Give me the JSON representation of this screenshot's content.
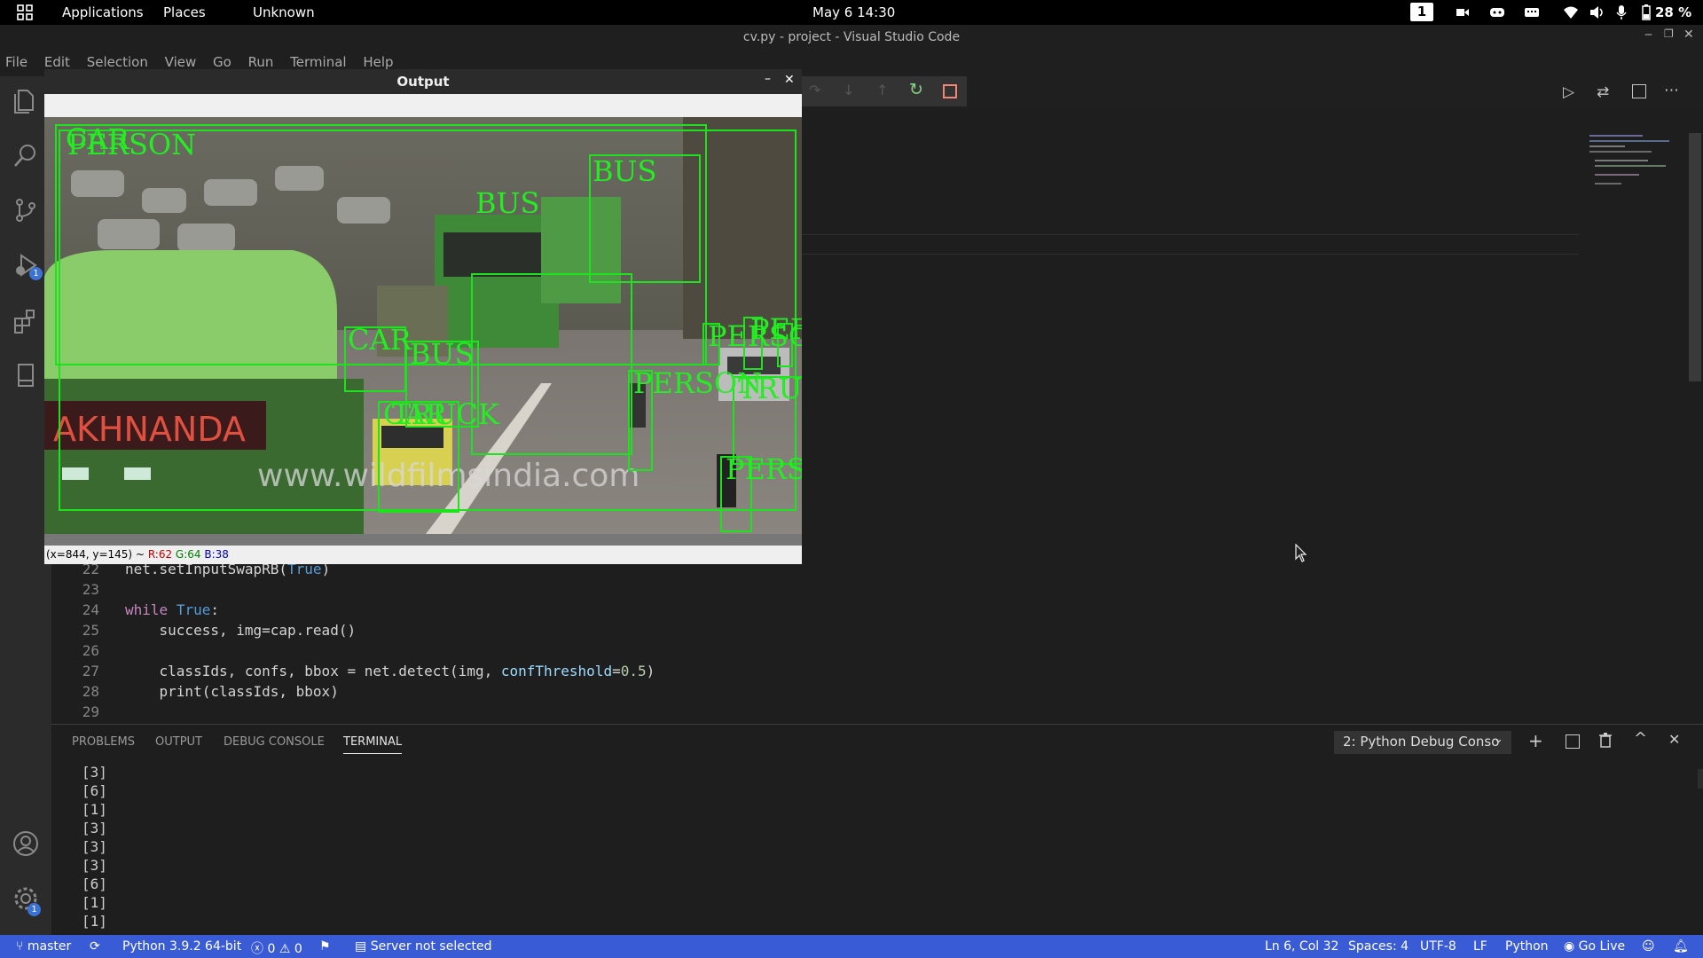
{
  "topbar": {
    "applications": "Applications",
    "places": "Places",
    "unknown": "Unknown",
    "datetime": "May 6  14:30",
    "workspace": "1",
    "battery": "28 %"
  },
  "window": {
    "title": "cv.py - project - Visual Studio Code"
  },
  "menu": [
    "File",
    "Edit",
    "Selection",
    "View",
    "Go",
    "Run",
    "Terminal",
    "Help"
  ],
  "activity": {
    "debug_badge": "1",
    "settings_badge": "1"
  },
  "code": {
    "lines": [
      {
        "n": "22",
        "parts": [
          [
            "",
            "net.setInputSwapRB("
          ],
          [
            "bl",
            "True"
          ],
          [
            "",
            ")"
          ]
        ]
      },
      {
        "n": "23",
        "parts": []
      },
      {
        "n": "24",
        "parts": [
          [
            "kw",
            "while"
          ],
          [
            "",
            " "
          ],
          [
            "bl",
            "True"
          ],
          [
            "",
            ":"
          ]
        ]
      },
      {
        "n": "25",
        "parts": [
          [
            "",
            "    success, img=cap.read()"
          ]
        ]
      },
      {
        "n": "26",
        "parts": []
      },
      {
        "n": "27",
        "parts": [
          [
            "",
            "    classIds, confs, bbox = net.detect(img, "
          ],
          [
            "pm",
            "confThreshold"
          ],
          [
            "",
            "="
          ],
          [
            "nm",
            "0.5"
          ],
          [
            "",
            ")"
          ]
        ]
      },
      {
        "n": "28",
        "parts": [
          [
            "",
            "    print(classIds, bbox)"
          ]
        ]
      },
      {
        "n": "29",
        "parts": []
      }
    ]
  },
  "panel": {
    "tabs": [
      "PROBLEMS",
      "OUTPUT",
      "DEBUG CONSOLE",
      "TERMINAL"
    ],
    "active_tab": "TERMINAL",
    "terminal_select": "2: Python Debug Conso",
    "terminal_lines": [
      "[3]",
      "[6]",
      "[1]",
      "[3]",
      "[3]",
      "[3]",
      "[6]",
      "[1]",
      "[1]"
    ]
  },
  "statusbar": {
    "branch": "master",
    "python": "Python 3.9.2 64-bit",
    "errors": "0",
    "warnings": "0",
    "server": "Server not selected",
    "position": "Ln 6, Col 32",
    "spaces": "Spaces: 4",
    "encoding": "UTF-8",
    "eol": "LF",
    "language": "Python",
    "golive": "Go Live"
  },
  "cv_window": {
    "title": "Output",
    "status_prefix": "(x=844, y=145) ~",
    "r": "R:62",
    "g": "G:64",
    "b": "B:38",
    "watermark": "www.wildfilmsindia.com",
    "sign_text": "AKHNANDA",
    "labels": [
      "CAR",
      "PERSON",
      "BUS",
      "BUS",
      "CAR",
      "BUS",
      "PERSON",
      "PERSO",
      "PERSON",
      "TRUCK",
      "CAR",
      "TRUCK",
      "PERSON"
    ]
  },
  "colors": {
    "accent": "#3a5bd6",
    "detect": "#1de21d"
  }
}
